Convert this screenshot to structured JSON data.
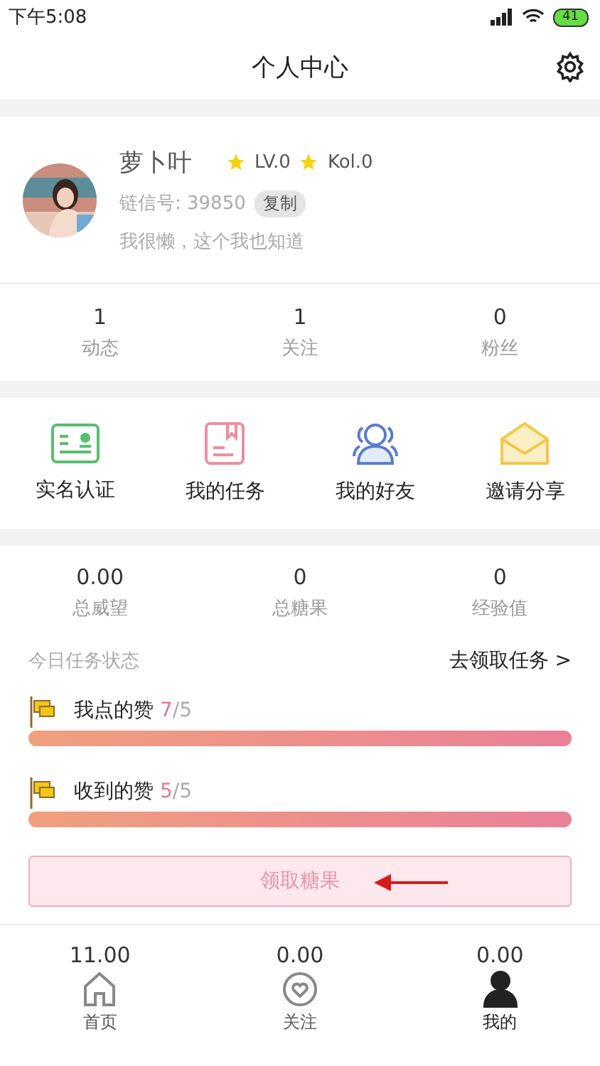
{
  "status_bar": {
    "time": "下午5:08",
    "battery": "41"
  },
  "header": {
    "title": "个人中心"
  },
  "profile": {
    "name": "萝卜叶",
    "badges": [
      "LV.0",
      "Kol.0"
    ],
    "id_text": "链信号: 39850",
    "copy_button": "复制",
    "bio": "我很懒，这个我也知道"
  },
  "social_stats": [
    {
      "value": "1",
      "label": "动态"
    },
    {
      "value": "1",
      "label": "关注"
    },
    {
      "value": "0",
      "label": "粉丝"
    }
  ],
  "shortcuts": [
    {
      "kind": "idcard",
      "label": "实名认证"
    },
    {
      "kind": "book",
      "label": "我的任务"
    },
    {
      "kind": "friends",
      "label": "我的好友"
    },
    {
      "kind": "mail",
      "label": "邀请分享"
    }
  ],
  "account_stats": [
    {
      "value": "0.00",
      "label": "总威望"
    },
    {
      "value": "0",
      "label": "总糖果"
    },
    {
      "value": "0",
      "label": "经验值"
    }
  ],
  "tasks": {
    "title": "今日任务状态",
    "link": "去领取任务 >",
    "items": [
      {
        "label": "我点的赞",
        "done": "7",
        "total": "/5",
        "level": 1
      },
      {
        "label": "收到的赞",
        "done": "5",
        "total": "/5",
        "level": 1
      }
    ],
    "claim_button": "领取糖果"
  },
  "bottom_values": [
    "11.00",
    "0.00",
    "0.00"
  ],
  "tab_bar": [
    {
      "kind": "home",
      "label": "首页",
      "selected": false
    },
    {
      "kind": "heart",
      "label": "关注",
      "selected": false
    },
    {
      "kind": "person",
      "label": "我的",
      "selected": true
    }
  ]
}
